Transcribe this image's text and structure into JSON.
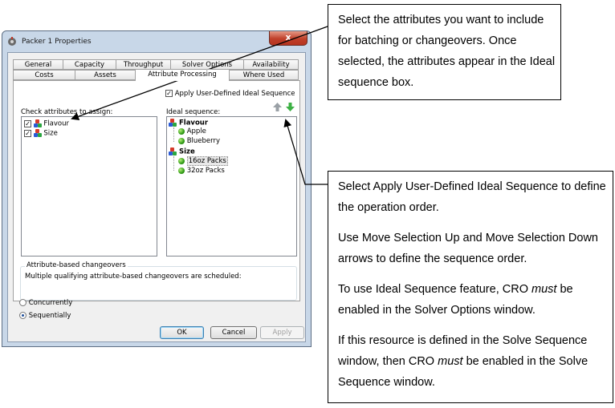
{
  "window": {
    "title": "Packer 1 Properties",
    "close_glyph": "x"
  },
  "tabs_row1": [
    "General",
    "Capacity",
    "Throughput",
    "Solver Options",
    "Availability"
  ],
  "tabs_row2": [
    "Costs",
    "Assets",
    "Attribute Processing",
    "Where Used"
  ],
  "apply_ideal": {
    "label": "Apply User-Defined Ideal Sequence",
    "checked": true
  },
  "check_attrs": {
    "label": "Check attributes to assign:",
    "items": [
      {
        "label": "Flavour",
        "checked": true
      },
      {
        "label": "Size",
        "checked": true
      }
    ]
  },
  "ideal_sequence": {
    "label": "Ideal sequence:",
    "groups": [
      {
        "label": "Flavour",
        "items": [
          "Apple",
          "Blueberry"
        ]
      },
      {
        "label": "Size",
        "items": [
          "16oz Packs",
          "32oz Packs"
        ]
      }
    ],
    "selected_item": "16oz Packs"
  },
  "changeovers": {
    "group_label": "Attribute-based changeovers",
    "prompt": "Multiple qualifying attribute-based changeovers are scheduled:",
    "options": [
      {
        "label": "Concurrently",
        "selected": false
      },
      {
        "label": "Sequentially",
        "selected": true
      }
    ]
  },
  "buttons": {
    "ok": "OK",
    "cancel": "Cancel",
    "apply": "Apply"
  },
  "callout_top": {
    "text": "Select the attributes you want to include for batching or changeovers. Once selected, the attributes appear in the Ideal sequence box."
  },
  "callout_bottom": {
    "p1": "Select Apply User-Defined Ideal Sequence to define the operation order.",
    "p2": "Use Move Selection Up and Move Selection Down arrows to define the sequence order.",
    "p3_pre": "To use Ideal Sequence feature, CRO ",
    "p3_em": "must",
    "p3_post": " be enabled in the Solver Options window.",
    "p4_pre": "If this resource is defined in the Solve Sequence window, then CRO ",
    "p4_em": "must",
    "p4_post": " be enabled in the Solve Sequence window."
  },
  "colors": {
    "move_up": "#9aa0a6",
    "move_down": "#3cb043"
  }
}
